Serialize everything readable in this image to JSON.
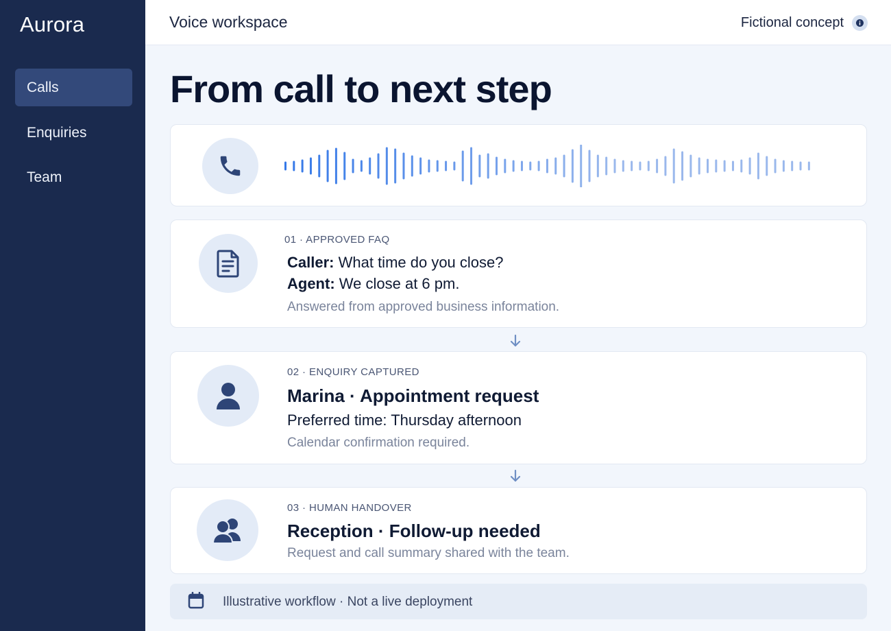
{
  "sidebar": {
    "brand": "Aurora",
    "items": [
      {
        "label": "Calls",
        "active": true
      },
      {
        "label": "Enquiries",
        "active": false
      },
      {
        "label": "Team",
        "active": false
      }
    ]
  },
  "header": {
    "title": "Voice workspace",
    "badge": "Fictional concept"
  },
  "main": {
    "headline": "From call to next step",
    "steps": [
      {
        "label": "01 · APPROVED FAQ",
        "caller_prefix": "Caller:",
        "caller_text": "What time do you close?",
        "agent_prefix": "Agent:",
        "agent_text": "We close at 6 pm.",
        "note": "Answered from approved business information."
      },
      {
        "label": "02 · ENQUIRY CAPTURED",
        "title": "Marina  ·  Appointment request",
        "detail": "Preferred time:  Thursday afternoon",
        "note": "Calendar confirmation required."
      },
      {
        "label": "03 · HUMAN HANDOVER",
        "title": "Reception · Follow-up needed",
        "note": "Request and call summary shared with the team."
      }
    ],
    "footer": "Illustrative workflow · Not a live deployment"
  },
  "colors": {
    "sidebar": "#1a2a4e",
    "sidebar_active": "#33497a",
    "accent": "#3f74d6",
    "icon": "#2e4577",
    "background": "#f2f6fc"
  },
  "icons": {
    "info": "info-icon",
    "phone": "phone-icon",
    "faq": "document-icon",
    "enquiry": "person-icon",
    "handover": "people-icon",
    "arrow": "arrow-down-icon",
    "footer": "calendar-icon"
  }
}
